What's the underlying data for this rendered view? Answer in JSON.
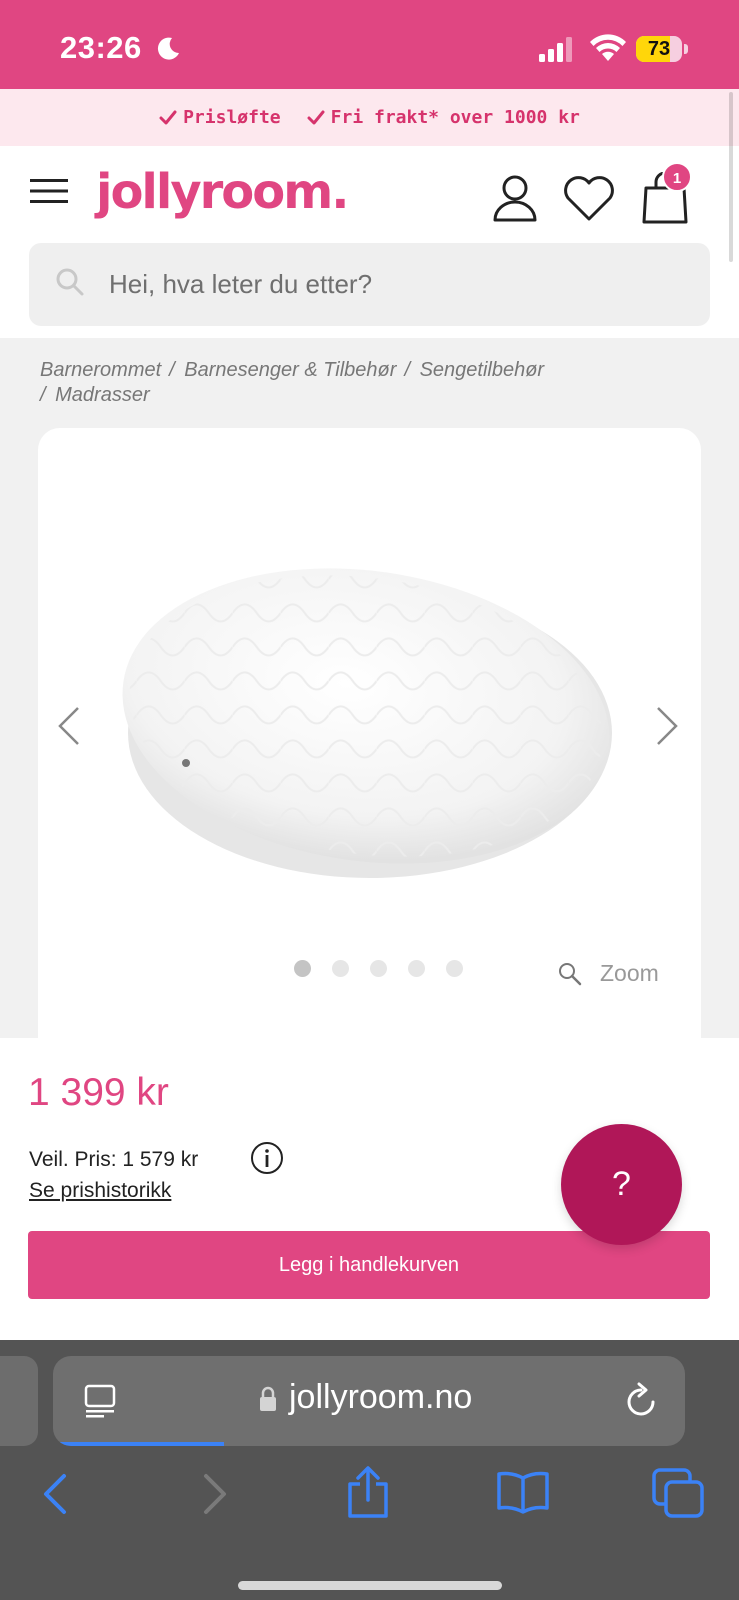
{
  "status_bar": {
    "time": "23:26",
    "battery": "73",
    "battery_level": 0.73
  },
  "promo": {
    "items": [
      "Prisløfte",
      "Fri frakt* over 1000 kr"
    ]
  },
  "header": {
    "logo": "jollyroom.",
    "cart_count": "1"
  },
  "search": {
    "placeholder": "Hei, hva leter du etter?"
  },
  "breadcrumb": {
    "items": [
      "Barnerommet",
      "Barnesenger & Tilbehør",
      "Sengetilbehør",
      "Madrasser"
    ]
  },
  "gallery": {
    "dot_count": 5,
    "active_dot": 0,
    "zoom_label": "Zoom"
  },
  "product": {
    "price": "1 399 kr",
    "rrp": "Veil. Pris: 1 579 kr",
    "history_link": "Se prishistorikk",
    "add_to_cart": "Legg i handlekurven"
  },
  "help": {
    "label": "?"
  },
  "browser": {
    "url": "jollyroom.no",
    "load_progress": 0.27
  },
  "colors": {
    "brand": "#e04682",
    "brand_dark": "#b01758",
    "promo_bg": "#fde8ee",
    "link_blue": "#3b82f6"
  }
}
